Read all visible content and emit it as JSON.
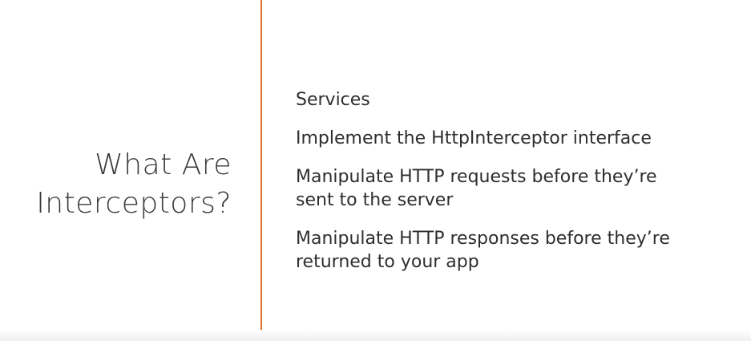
{
  "slide": {
    "title_lines": [
      "What Are",
      "Interceptors?"
    ],
    "bullets": [
      [
        "Services"
      ],
      [
        "Implement the HttpInterceptor interface"
      ],
      [
        "Manipulate HTTP requests before they’re",
        "sent to the server"
      ],
      [
        "Manipulate HTTP responses before they’re",
        "returned to your app"
      ]
    ]
  },
  "colors": {
    "divider": "#e26f32",
    "title_text": "#3a3a3a",
    "bullet_text": "#2e2e2e",
    "background": "#ffffff"
  }
}
